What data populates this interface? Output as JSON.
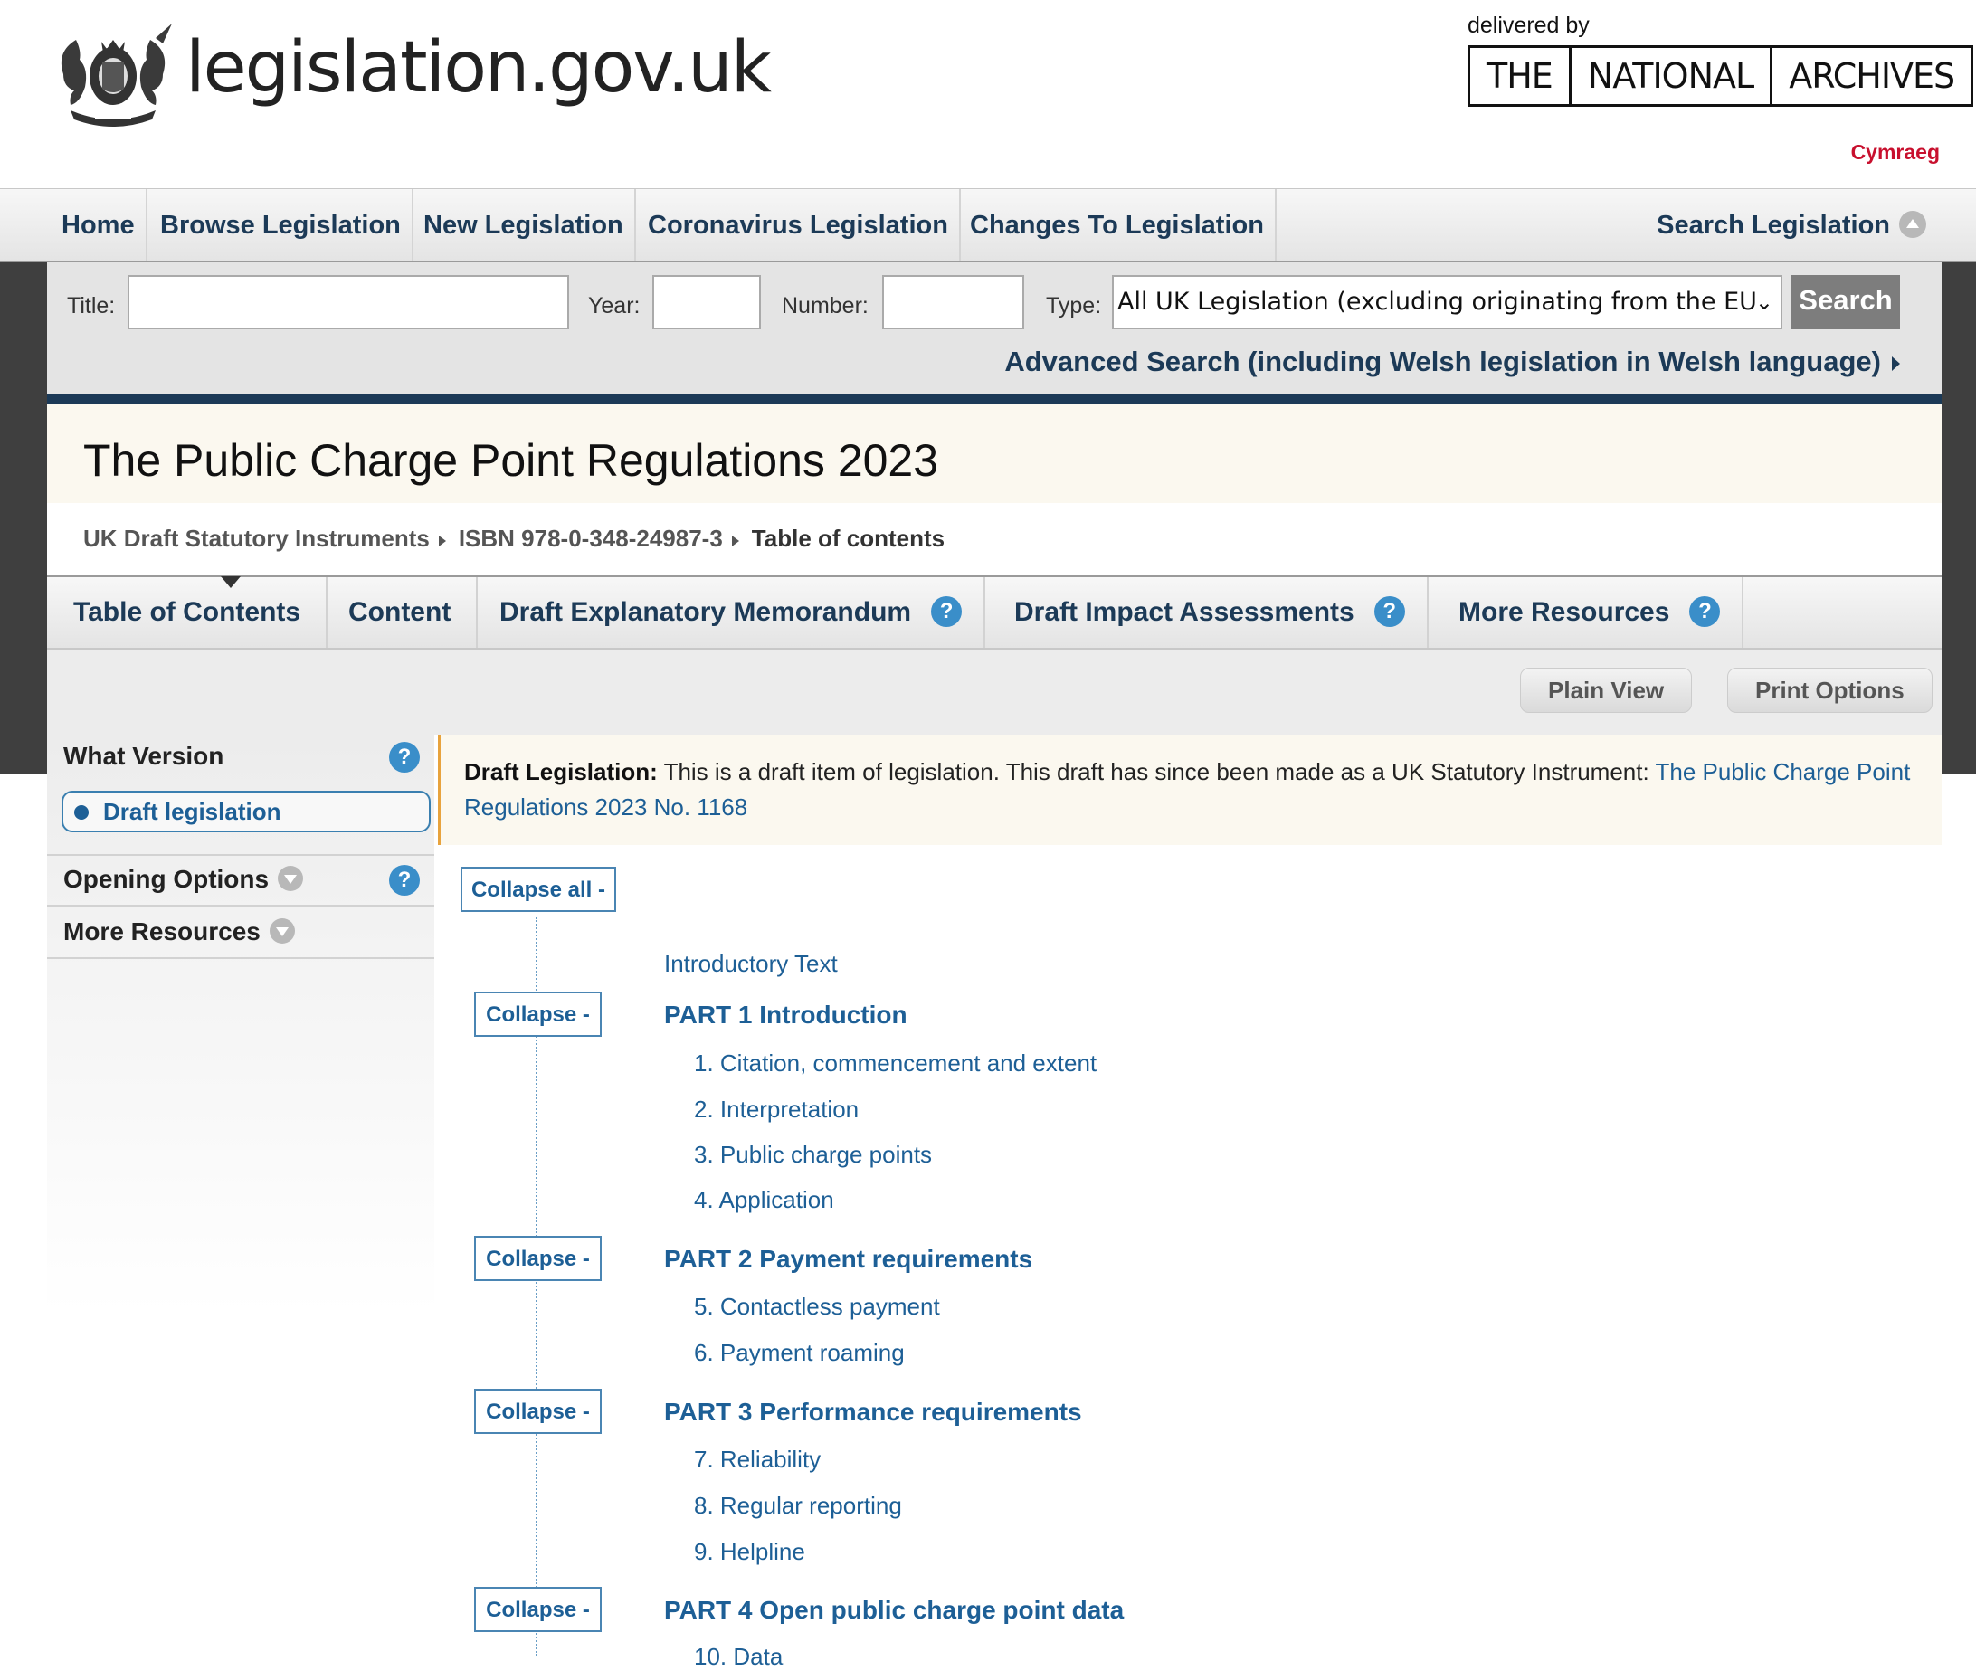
{
  "header": {
    "site_name": "legislation.gov.uk",
    "delivered_by": "delivered by",
    "tna": [
      "THE",
      "NATIONAL",
      "ARCHIVES"
    ],
    "language_link": "Cymraeg"
  },
  "nav": {
    "items": [
      "Home",
      "Browse Legislation",
      "New Legislation",
      "Coronavirus Legislation",
      "Changes To Legislation"
    ],
    "search_toggle": "Search Legislation"
  },
  "search": {
    "title_label": "Title:",
    "year_label": "Year:",
    "number_label": "Number:",
    "type_label": "Type:",
    "type_value": "All UK Legislation (excluding originating from the EU",
    "button": "Search",
    "advanced": "Advanced Search (including Welsh legislation in Welsh language)"
  },
  "page": {
    "title": "The Public Charge Point Regulations 2023",
    "breadcrumb": [
      "UK Draft Statutory Instruments",
      "ISBN 978-0-348-24987-3",
      "Table of contents"
    ]
  },
  "tabs": [
    {
      "label": "Table of Contents",
      "help": false
    },
    {
      "label": "Content",
      "help": false
    },
    {
      "label": "Draft Explanatory Memorandum",
      "help": true
    },
    {
      "label": "Draft Impact Assessments",
      "help": true
    },
    {
      "label": "More Resources",
      "help": true
    }
  ],
  "tools": {
    "plain_view": "Plain View",
    "print_options": "Print Options"
  },
  "help_glyph": "?",
  "sidebar": {
    "what_version": "What Version",
    "draft_legislation": "Draft legislation",
    "opening_options": "Opening Options",
    "more_resources": "More Resources"
  },
  "notice": {
    "label": "Draft Legislation:",
    "text": "This is a draft item of legislation. This draft has since been made as a UK Statutory Instrument:",
    "link": "The Public Charge Point Regulations 2023 No. 1168"
  },
  "toc": {
    "collapse_all": "Collapse all -",
    "collapse": "Collapse -",
    "intro": "Introductory Text",
    "parts": [
      {
        "title": "PART 1 Introduction",
        "items": [
          "1. Citation, commencement and extent",
          "2. Interpretation",
          "3. Public charge points",
          "4. Application"
        ]
      },
      {
        "title": "PART 2 Payment requirements",
        "items": [
          "5. Contactless payment",
          "6. Payment roaming"
        ]
      },
      {
        "title": "PART 3 Performance requirements",
        "items": [
          "7. Reliability",
          "8. Regular reporting",
          "9. Helpline"
        ]
      },
      {
        "title": "PART 4 Open public charge point data",
        "items": [
          "10. Data"
        ]
      }
    ]
  },
  "colors": {
    "link": "#1d5f96",
    "nav_text": "#1c3a57",
    "welsh_link": "#c8102e",
    "notice_border": "#e8a33d"
  }
}
